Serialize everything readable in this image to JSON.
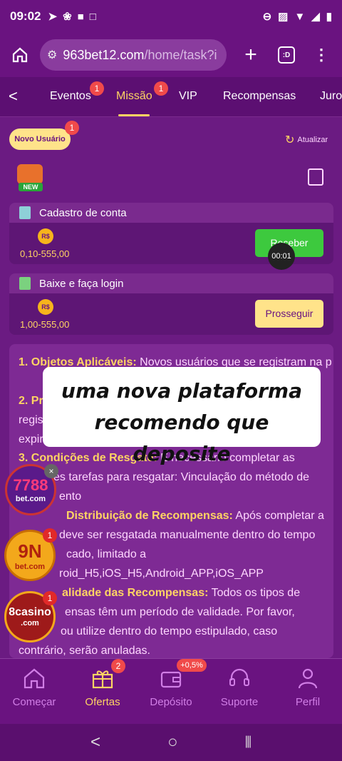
{
  "status_bar": {
    "time": "09:02",
    "left_icons": [
      "telegram-icon",
      "figma-icon",
      "video-camera-icon",
      "square-icon"
    ],
    "right_icons": [
      "do-not-disturb-icon",
      "cast-icon",
      "wifi-icon",
      "signal-icon",
      "battery-icon"
    ]
  },
  "browser": {
    "url_host": "963bet12.com",
    "url_path": "/home/task?i",
    "tab_switcher_label": ":D"
  },
  "nav_tabs": [
    {
      "label": "Eventos",
      "badge": "1"
    },
    {
      "label": "Missão",
      "badge": "1",
      "active": true
    },
    {
      "label": "VIP"
    },
    {
      "label": "Recompensas"
    },
    {
      "label": "Juro"
    }
  ],
  "header": {
    "novo_usuario": "Novo Usuário",
    "novo_badge": "1",
    "atualizar": "Atualizar",
    "new_label": "NEW"
  },
  "tasks": [
    {
      "title": "Cadastro de conta",
      "currency": "R$",
      "range": "0,10-555,00",
      "button": "Receber",
      "button_style": "green"
    },
    {
      "title": "Baixe e faça login",
      "currency": "R$",
      "range": "1,00-555,00",
      "button": "Prosseguir",
      "button_style": "yellow"
    }
  ],
  "timer": "00:01",
  "rules": {
    "p1_head": "1. Objetos Aplicáveis:",
    "p1_text": " Novos usuários que se registram na p",
    "p2_head": "2. Pr",
    "p2_line2": "regis",
    "p2_line3": "expir",
    "p3_head": "3. Condições de Resgate:",
    "p3_text": " É necessário completar as",
    "p3_line2": "es tarefas para resgatar: Vinculação do método de",
    "p3_line3": "ento",
    "p4_head": "Distribuição de Recompensas:",
    "p4_text": " Após completar a",
    "p4_line2": "deve ser resgatada manualmente dentro do tempo",
    "p4_line3": "cado, limitado a",
    "p4_line4": "roid_H5,iOS_H5,Android_APP,iOS_APP",
    "p5_head": "alidade das Recompensas:",
    "p5_text": " Todos os tipos de",
    "p5_line2": "ensas têm um período de validade. Por favor,",
    "p5_line3": "ou utilize dentro do tempo estipulado, caso",
    "p5_line4": "contrário, serão anuladas."
  },
  "overlay": {
    "line1": "uma nova plataforma",
    "line2": "recomendo que deposite"
  },
  "floating_ads": [
    {
      "name": "7788",
      "sub": "bet.com",
      "close": "×"
    },
    {
      "name": "9N",
      "sub": "bet.com",
      "badge": "1"
    },
    {
      "name": "8casino",
      "sub": ".com",
      "badge": "1"
    }
  ],
  "bottom_nav": [
    {
      "label": "Começar",
      "icon": "home-icon"
    },
    {
      "label": "Ofertas",
      "icon": "gift-icon",
      "badge": "2",
      "active": true
    },
    {
      "label": "Depósito",
      "icon": "wallet-icon",
      "badge": "+0,5%"
    },
    {
      "label": "Suporte",
      "icon": "headset-icon"
    },
    {
      "label": "Perfil",
      "icon": "user-icon"
    }
  ],
  "colors": {
    "background": "#5a0f6e",
    "accent": "#ffd463",
    "green_button": "#3dc93e",
    "badge_red": "#f04a4a"
  }
}
